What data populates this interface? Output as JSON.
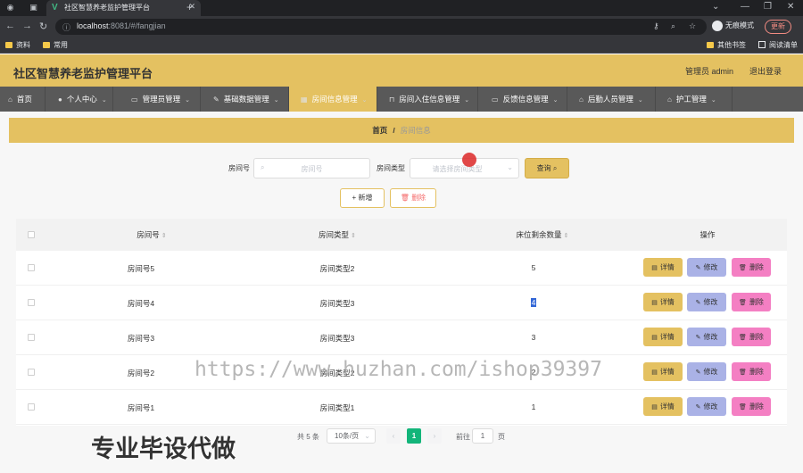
{
  "browser": {
    "tab_title": "社区智慧养老监护管理平台",
    "url_host": "localhost",
    "url_rest": ":8081/#/fangjian",
    "incognito_label": "无痕模式",
    "update_label": "更新",
    "bookmarks": [
      "资料",
      "常用"
    ],
    "bookmarks_right": [
      "其他书签",
      "阅读清单"
    ]
  },
  "header": {
    "title": "社区智慧养老监护管理平台",
    "admin": "管理员 admin",
    "logout": "退出登录"
  },
  "nav": [
    {
      "label": "首页",
      "icon": "home-icon",
      "glyph": "⌂",
      "has_menu": false
    },
    {
      "label": "个人中心",
      "icon": "user-icon",
      "glyph": "●",
      "has_menu": true
    },
    {
      "label": "管理员管理",
      "icon": "admin-icon",
      "glyph": "▭",
      "has_menu": true
    },
    {
      "label": "基础数据管理",
      "icon": "data-icon",
      "glyph": "✎",
      "has_menu": true
    },
    {
      "label": "房间信息管理",
      "icon": "grid-icon",
      "glyph": "▦",
      "has_menu": true
    },
    {
      "label": "房间入住信息管理",
      "icon": "checkin-icon",
      "glyph": "⊓",
      "has_menu": true
    },
    {
      "label": "反馈信息管理",
      "icon": "message-icon",
      "glyph": "▭",
      "has_menu": true
    },
    {
      "label": "后勤人员管理",
      "icon": "staff-icon",
      "glyph": "⌂",
      "has_menu": true
    },
    {
      "label": "护工管理",
      "icon": "nurse-icon",
      "glyph": "⌂",
      "has_menu": true
    }
  ],
  "breadcrumb": {
    "home": "首页",
    "sep": "/",
    "current": "房间信息"
  },
  "search": {
    "room_label": "房间号",
    "room_placeholder": "房间号",
    "type_label": "房间类型",
    "type_placeholder": "请选择房间类型",
    "query_button": "查询"
  },
  "actions": {
    "add": "新增",
    "delete": "删除"
  },
  "table": {
    "columns": [
      "房间号",
      "房间类型",
      "床位剩余数量",
      "操作"
    ],
    "rows": [
      {
        "room": "房间号5",
        "type": "房间类型2",
        "beds": "5"
      },
      {
        "room": "房间号4",
        "type": "房间类型3",
        "beds": "4"
      },
      {
        "room": "房间号3",
        "type": "房间类型3",
        "beds": "3"
      },
      {
        "room": "房间号2",
        "type": "房间类型2",
        "beds": "2"
      },
      {
        "room": "房间号1",
        "type": "房间类型1",
        "beds": "1"
      }
    ],
    "row_buttons": {
      "detail": "详情",
      "edit": "修改",
      "remove": "删除"
    }
  },
  "pagination": {
    "total": "共 5 条",
    "page_size": "10条/页",
    "current_page": "1",
    "goto_prefix": "前往",
    "goto_value": "1",
    "goto_suffix": "页"
  },
  "overlay": {
    "watermark_url": "https://www.huzhan.com/ishop39397",
    "watermark_text": "专业毕设代做"
  },
  "colors": {
    "accent": "#e4c161",
    "nav_bg": "#595959",
    "edit": "#aab2e6",
    "remove": "#f47fc3",
    "page_active": "#13b57a"
  }
}
